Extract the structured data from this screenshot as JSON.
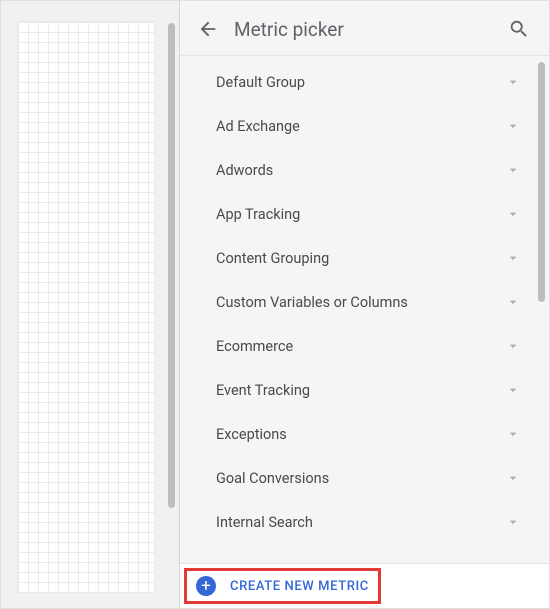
{
  "header": {
    "title": "Metric picker"
  },
  "groups": [
    {
      "label": "Default Group"
    },
    {
      "label": "Ad Exchange"
    },
    {
      "label": "Adwords"
    },
    {
      "label": "App Tracking"
    },
    {
      "label": "Content Grouping"
    },
    {
      "label": "Custom Variables or Columns"
    },
    {
      "label": "Ecommerce"
    },
    {
      "label": "Event Tracking"
    },
    {
      "label": "Exceptions"
    },
    {
      "label": "Goal Conversions"
    },
    {
      "label": "Internal Search"
    }
  ],
  "footer": {
    "create_label": "CREATE NEW METRIC"
  }
}
